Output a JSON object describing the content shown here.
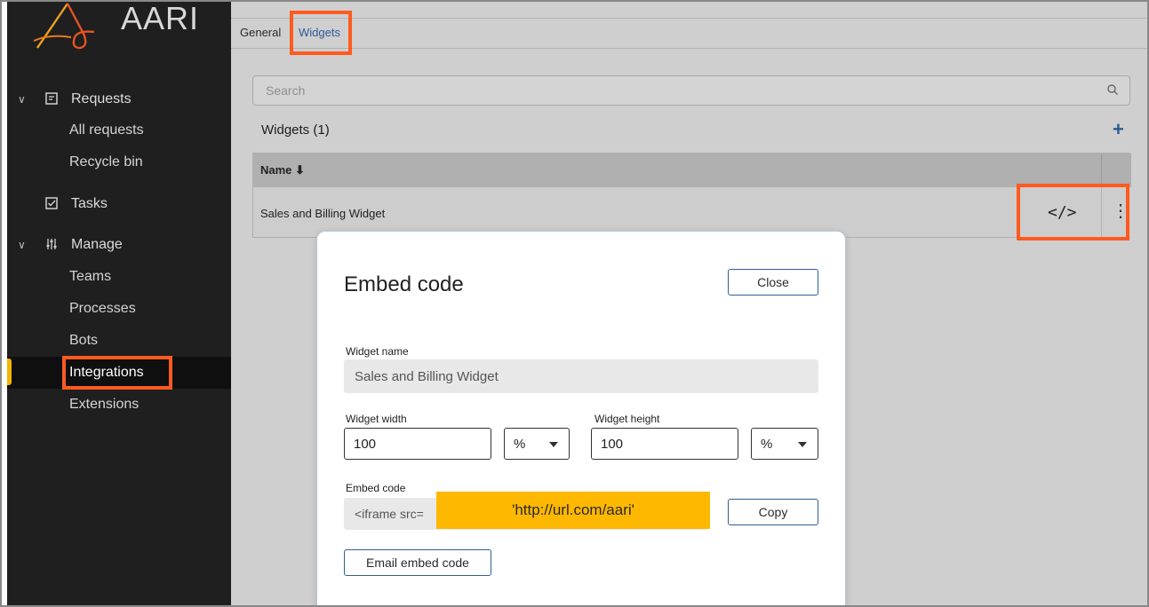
{
  "app": {
    "logo_text": "AARI"
  },
  "sidebar": {
    "groups": [
      {
        "label": "Requests",
        "icon": "document-icon"
      },
      {
        "label": "Tasks",
        "icon": "checkbox-icon"
      },
      {
        "label": "Manage",
        "icon": "sliders-icon"
      }
    ],
    "items": {
      "all_requests": "All requests",
      "recycle_bin": "Recycle bin",
      "teams": "Teams",
      "processes": "Processes",
      "bots": "Bots",
      "integrations": "Integrations",
      "extensions": "Extensions"
    },
    "active_item": "Integrations"
  },
  "tabs": {
    "general": "General",
    "widgets": "Widgets"
  },
  "search": {
    "placeholder": "Search"
  },
  "widgets": {
    "title": "Widgets (1)",
    "columns": {
      "name": "Name ⬇"
    },
    "rows": [
      {
        "name": "Sales and Billing Widget"
      }
    ]
  },
  "modal": {
    "title": "Embed code",
    "close_label": "Close",
    "widget_name_label": "Widget name",
    "widget_name_value": "Sales and Billing Widget",
    "width_label": "Widget width",
    "width_value": "100",
    "width_unit": "%",
    "height_label": "Widget height",
    "height_value": "100",
    "height_unit": "%",
    "embed_label": "Embed code",
    "embed_prefix": "<iframe src=",
    "embed_url": "'http://url.com/aari'",
    "copy_label": "Copy",
    "email_label": "Email embed code"
  },
  "colors": {
    "highlight": "#ff5a1f",
    "accent": "#f5b400",
    "link": "#2a5a9a"
  }
}
